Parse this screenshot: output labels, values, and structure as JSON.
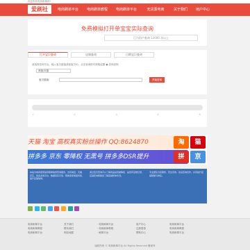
{
  "topbar": {
    "text": "欢迎来到电商刷单网!"
  },
  "brand": {
    "logo": "爱刷社",
    "accent": "#e94b3c"
  },
  "nav": {
    "items": [
      "电商刷单平台",
      "电商刷单教程",
      "电商刷单平台",
      "无货源电商",
      "关于我们",
      "用户中心"
    ]
  },
  "hero": {
    "title": "免费模拟打开单宝宝实际查询",
    "subtitle": "已为用户查询 12000 次以上"
  },
  "tabs": [
    "打开宝贝查询",
    "店铺查询",
    "日期宝贝查询"
  ],
  "form": {
    "tip": "请选择查询平台，输入宝贝链接或者宝贝ID，点击查询即可获取结果 ● 查询说明",
    "select_value": "淘宝/天猫",
    "input_label": "宝贝链接:",
    "button": "开始查询"
  },
  "progress": {
    "value": 0,
    "steps": [
      "①",
      "②",
      "③",
      "④",
      "⑤"
    ]
  },
  "banner": {
    "line1": "天猫  淘宝  高权真实粉丝操作  QQ:8624870",
    "line2": "拼多多 京东  零降权  无黑号  拼多多DSR提升",
    "badge1": "淘",
    "badge2": "猫",
    "badge3": "拼",
    "badge4": "京"
  },
  "info": {
    "col1": "本站为电商卖家提供刷单信誉查询服务，支持淘宝、天猫、京东、拼多多等平台，数据真实可靠，帮助卖家规避风险，提升店铺信誉。",
    "col2": "通过宝贝查询可以了解商品是否被降权、是否有违规记录，店铺查询帮助您了解店铺整体状况。",
    "col3": "专业团队为您服务，安全高效，欢迎咨询合作，共同提升店铺销量与排名。"
  },
  "footer": {
    "cols": [
      [
        "电商刷单平台",
        "电商刷单教程",
        "电商刷单平台"
      ],
      [
        "关于我们",
        "联系我们",
        "网站地图"
      ],
      [
        "·  电商刷单平台",
        "·  电商刷单教程",
        "·  刷单平台"
      ],
      [
        "用户中心",
        "注册登录",
        "帮助中心"
      ],
      [
        "电商刷单平台",
        "电商刷单教程",
        "电商刷单平台"
      ]
    ],
    "copyright": "版权所有 © 电商刷单平台 All Rights Reserved 备案号"
  }
}
